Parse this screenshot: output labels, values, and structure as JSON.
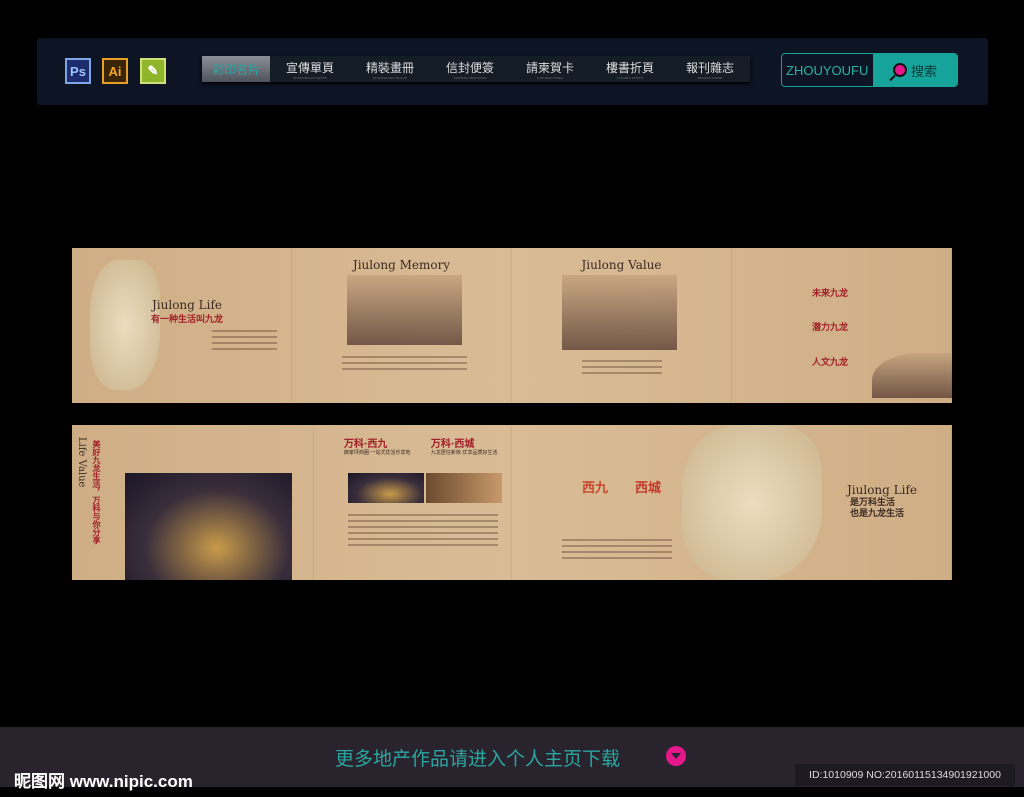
{
  "toolbar": {
    "apps": [
      "Ps",
      "Ai"
    ],
    "nav": [
      {
        "label": "彩印名片"
      },
      {
        "label": "宣傳單頁",
        "sub": "XUANCHUAN DANYE"
      },
      {
        "label": "精裝畫冊",
        "sub": "JINGZHUANG HUACE"
      },
      {
        "label": "信封便簽",
        "sub": "XINFENG BIANQIAN"
      },
      {
        "label": "請柬賀卡",
        "sub": "QINGJIAN HEKA"
      },
      {
        "label": "樓書折頁",
        "sub": "LOUSHU ZHEYE"
      },
      {
        "label": "報刊雜志",
        "sub": "BAOKAN ZAZHI"
      }
    ],
    "search_value": "ZHOUYOUFU",
    "search_button": "搜索"
  },
  "brochure": {
    "top": {
      "life_title": "Jiulong Life",
      "life_sub": "有一种生活叫九龙",
      "memory_title": "Jiulong Memory",
      "value_title": "Jiulong Value",
      "features": [
        "未来九龙",
        "潜力九龙",
        "人文九龙"
      ]
    },
    "bottom": {
      "vertical_title": "Life Value",
      "slogan": "美好九龙生活，万科与你分享",
      "col1_title": "万科·西九",
      "col1_sub": "御家坪商圈·一站式优活乐享地",
      "col2_title": "万科·西城",
      "col2_sub": "九龙居住新核·优享品质好生活",
      "logos": [
        "西九",
        "西城"
      ],
      "closing_title": "Jiulong Life",
      "closing_line1": "是万科生活",
      "closing_line2": "也是九龙生活"
    }
  },
  "footer": {
    "more_text": "更多地产作品请进入个人主页下载",
    "site": "昵图网 www.nipic.com",
    "id_text": "ID:1010909 NO:20160115134901921000"
  },
  "colors": {
    "accent": "#16a39a",
    "pink": "#e5178a",
    "paper": "#d3b48c"
  }
}
